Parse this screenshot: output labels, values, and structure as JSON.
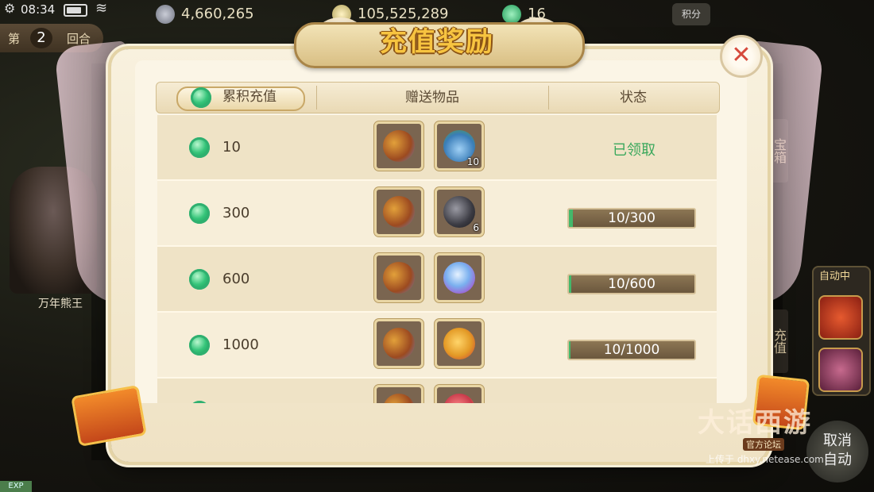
{
  "status_bar": {
    "time": "08:34"
  },
  "currencies": [
    {
      "value": "4,660,265",
      "color": "#8d8f9a"
    },
    {
      "value": "105,525,289",
      "color": "#a9c36a"
    },
    {
      "value": "16",
      "color": "#2fb06a"
    }
  ],
  "round": {
    "prefix": "第",
    "number": "2",
    "suffix": "回合"
  },
  "score_button": {
    "label": "积分"
  },
  "monster": {
    "name": "万年熊王"
  },
  "side_tabs": [
    "宝箱",
    "充值"
  ],
  "auto_panel": {
    "label": "自动中"
  },
  "cancel_auto": {
    "line1": "取消",
    "line2": "自动"
  },
  "dialog": {
    "title": "充值奖励",
    "headers": {
      "amount": "累积充值",
      "rewards": "赠送物品",
      "status": "状态"
    },
    "rows": [
      {
        "amount": "10",
        "items": [
          {
            "icon": "treasure-bag-icon"
          },
          {
            "icon": "herb-potion-icon",
            "qty": "10"
          }
        ],
        "status": "已领取",
        "claimed": true
      },
      {
        "amount": "300",
        "items": [
          {
            "icon": "treasure-bag-icon"
          },
          {
            "icon": "dark-ore-icon",
            "qty": "6"
          }
        ],
        "status": "10/300",
        "progress": 0.033
      },
      {
        "amount": "600",
        "items": [
          {
            "icon": "treasure-bag-icon"
          },
          {
            "icon": "crystal-orb-icon"
          }
        ],
        "status": "10/600",
        "progress": 0.017
      },
      {
        "amount": "1000",
        "items": [
          {
            "icon": "treasure-bag-icon"
          },
          {
            "icon": "lucky-bag-icon"
          }
        ],
        "status": "10/1000",
        "progress": 0.01
      },
      {
        "amount": "",
        "items": [
          {
            "icon": "treasure-bag-icon"
          },
          {
            "icon": "gift-bag-icon"
          }
        ],
        "status": ""
      }
    ]
  },
  "watermark": {
    "text": "大话西游",
    "sub": "官方论坛",
    "url": "上传于 dhxy.netease.com"
  },
  "exp_label": "EXP"
}
